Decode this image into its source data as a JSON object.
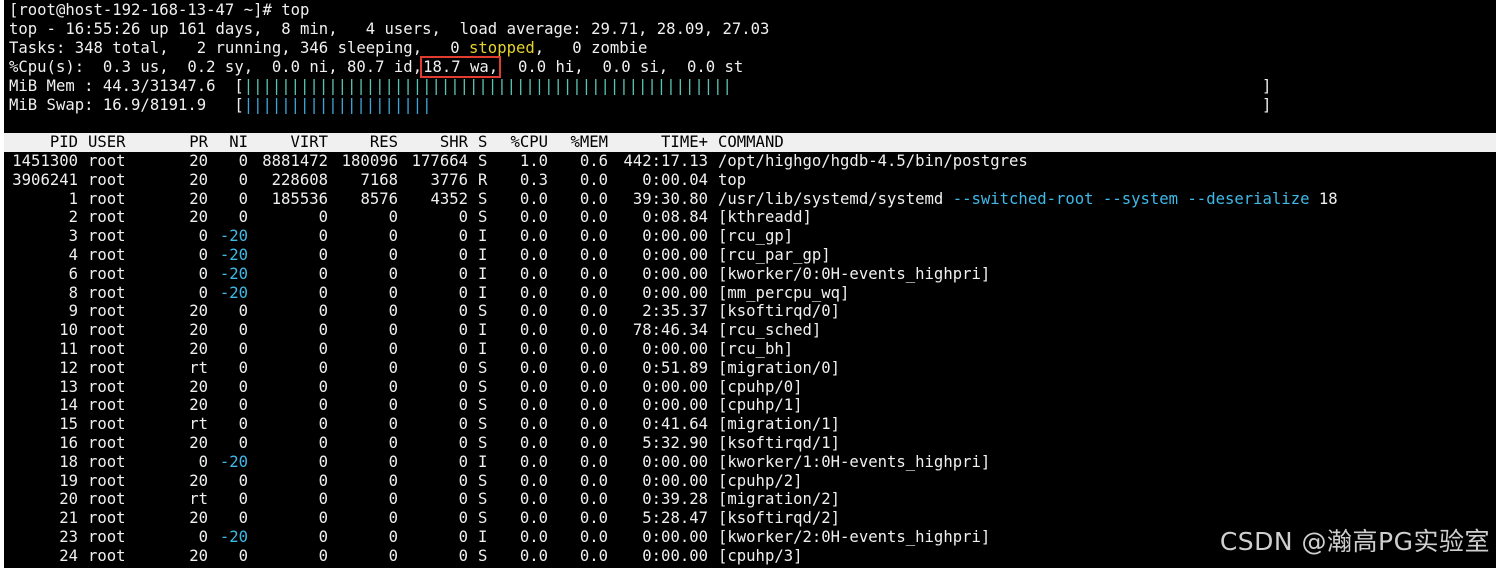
{
  "prompt_line": "[root@host-192-168-13-47 ~]# top",
  "summary": {
    "top_line": "top - 16:55:26 up 161 days,  8 min,   4 users,  load average: 29.71, 28.09, 27.03",
    "tasks_a": "Tasks: 348 total,   2 running, 346 sleeping,   0 ",
    "tasks_stopped": "stopped",
    "tasks_b": ",   0 zombie",
    "cpu_a": "%Cpu(s):  0.3 us,  0.2 sy,  0.0 ni, 80.7 id,",
    "cpu_wa": "18.7 wa,",
    "cpu_b": "  0.0 hi,  0.0 si,  0.0 st",
    "mem_label": "MiB Mem : 44.3/31347.6  [",
    "mem_bar": "||||||||||||||||||||||||||||||||||||||||||||||||||||",
    "swap_label": "MiB Swap: 16.9/8191.9   [",
    "swap_bar": "||||||||||||||||||||",
    "bar_close": "]"
  },
  "table_header": {
    "pid": "PID",
    "user": "USER",
    "pr": "PR",
    "ni": "NI",
    "virt": "VIRT",
    "res": "RES",
    "shr": "SHR",
    "s": "S",
    "cpu": "%CPU",
    "mem": "%MEM",
    "time": "TIME+",
    "command": "COMMAND"
  },
  "processes": [
    {
      "pid": "1451300",
      "user": "root",
      "pr": "20",
      "ni": "0",
      "virt": "8881472",
      "res": "180096",
      "shr": "177664",
      "s": "S",
      "cpu": "1.0",
      "mem": "0.6",
      "time": "442:17.13",
      "command": "/opt/highgo/hgdb-4.5/bin/postgres",
      "args": ""
    },
    {
      "pid": "3906241",
      "user": "root",
      "pr": "20",
      "ni": "0",
      "virt": "228608",
      "res": "7168",
      "shr": "3776",
      "s": "R",
      "cpu": "0.3",
      "mem": "0.0",
      "time": "0:00.04",
      "command": "top",
      "args": ""
    },
    {
      "pid": "1",
      "user": "root",
      "pr": "20",
      "ni": "0",
      "virt": "185536",
      "res": "8576",
      "shr": "4352",
      "s": "S",
      "cpu": "0.0",
      "mem": "0.0",
      "time": "39:30.80",
      "command": "/usr/lib/systemd/systemd",
      "args": " --switched-root --system --deserialize",
      "tail": " 18"
    },
    {
      "pid": "2",
      "user": "root",
      "pr": "20",
      "ni": "0",
      "virt": "0",
      "res": "0",
      "shr": "0",
      "s": "S",
      "cpu": "0.0",
      "mem": "0.0",
      "time": "0:08.84",
      "command": "[kthreadd]",
      "args": ""
    },
    {
      "pid": "3",
      "user": "root",
      "pr": "0",
      "ni": "-20",
      "virt": "0",
      "res": "0",
      "shr": "0",
      "s": "I",
      "cpu": "0.0",
      "mem": "0.0",
      "time": "0:00.00",
      "command": "[rcu_gp]",
      "args": ""
    },
    {
      "pid": "4",
      "user": "root",
      "pr": "0",
      "ni": "-20",
      "virt": "0",
      "res": "0",
      "shr": "0",
      "s": "I",
      "cpu": "0.0",
      "mem": "0.0",
      "time": "0:00.00",
      "command": "[rcu_par_gp]",
      "args": ""
    },
    {
      "pid": "6",
      "user": "root",
      "pr": "0",
      "ni": "-20",
      "virt": "0",
      "res": "0",
      "shr": "0",
      "s": "I",
      "cpu": "0.0",
      "mem": "0.0",
      "time": "0:00.00",
      "command": "[kworker/0:0H-events_highpri]",
      "args": ""
    },
    {
      "pid": "8",
      "user": "root",
      "pr": "0",
      "ni": "-20",
      "virt": "0",
      "res": "0",
      "shr": "0",
      "s": "I",
      "cpu": "0.0",
      "mem": "0.0",
      "time": "0:00.00",
      "command": "[mm_percpu_wq]",
      "args": ""
    },
    {
      "pid": "9",
      "user": "root",
      "pr": "20",
      "ni": "0",
      "virt": "0",
      "res": "0",
      "shr": "0",
      "s": "S",
      "cpu": "0.0",
      "mem": "0.0",
      "time": "2:35.37",
      "command": "[ksoftirqd/0]",
      "args": ""
    },
    {
      "pid": "10",
      "user": "root",
      "pr": "20",
      "ni": "0",
      "virt": "0",
      "res": "0",
      "shr": "0",
      "s": "I",
      "cpu": "0.0",
      "mem": "0.0",
      "time": "78:46.34",
      "command": "[rcu_sched]",
      "args": ""
    },
    {
      "pid": "11",
      "user": "root",
      "pr": "20",
      "ni": "0",
      "virt": "0",
      "res": "0",
      "shr": "0",
      "s": "I",
      "cpu": "0.0",
      "mem": "0.0",
      "time": "0:00.00",
      "command": "[rcu_bh]",
      "args": ""
    },
    {
      "pid": "12",
      "user": "root",
      "pr": "rt",
      "ni": "0",
      "virt": "0",
      "res": "0",
      "shr": "0",
      "s": "S",
      "cpu": "0.0",
      "mem": "0.0",
      "time": "0:51.89",
      "command": "[migration/0]",
      "args": ""
    },
    {
      "pid": "13",
      "user": "root",
      "pr": "20",
      "ni": "0",
      "virt": "0",
      "res": "0",
      "shr": "0",
      "s": "S",
      "cpu": "0.0",
      "mem": "0.0",
      "time": "0:00.00",
      "command": "[cpuhp/0]",
      "args": ""
    },
    {
      "pid": "14",
      "user": "root",
      "pr": "20",
      "ni": "0",
      "virt": "0",
      "res": "0",
      "shr": "0",
      "s": "S",
      "cpu": "0.0",
      "mem": "0.0",
      "time": "0:00.00",
      "command": "[cpuhp/1]",
      "args": ""
    },
    {
      "pid": "15",
      "user": "root",
      "pr": "rt",
      "ni": "0",
      "virt": "0",
      "res": "0",
      "shr": "0",
      "s": "S",
      "cpu": "0.0",
      "mem": "0.0",
      "time": "0:41.64",
      "command": "[migration/1]",
      "args": ""
    },
    {
      "pid": "16",
      "user": "root",
      "pr": "20",
      "ni": "0",
      "virt": "0",
      "res": "0",
      "shr": "0",
      "s": "S",
      "cpu": "0.0",
      "mem": "0.0",
      "time": "5:32.90",
      "command": "[ksoftirqd/1]",
      "args": ""
    },
    {
      "pid": "18",
      "user": "root",
      "pr": "0",
      "ni": "-20",
      "virt": "0",
      "res": "0",
      "shr": "0",
      "s": "I",
      "cpu": "0.0",
      "mem": "0.0",
      "time": "0:00.00",
      "command": "[kworker/1:0H-events_highpri]",
      "args": ""
    },
    {
      "pid": "19",
      "user": "root",
      "pr": "20",
      "ni": "0",
      "virt": "0",
      "res": "0",
      "shr": "0",
      "s": "S",
      "cpu": "0.0",
      "mem": "0.0",
      "time": "0:00.00",
      "command": "[cpuhp/2]",
      "args": ""
    },
    {
      "pid": "20",
      "user": "root",
      "pr": "rt",
      "ni": "0",
      "virt": "0",
      "res": "0",
      "shr": "0",
      "s": "S",
      "cpu": "0.0",
      "mem": "0.0",
      "time": "0:39.28",
      "command": "[migration/2]",
      "args": ""
    },
    {
      "pid": "21",
      "user": "root",
      "pr": "20",
      "ni": "0",
      "virt": "0",
      "res": "0",
      "shr": "0",
      "s": "S",
      "cpu": "0.0",
      "mem": "0.0",
      "time": "5:28.47",
      "command": "[ksoftirqd/2]",
      "args": ""
    },
    {
      "pid": "23",
      "user": "root",
      "pr": "0",
      "ni": "-20",
      "virt": "0",
      "res": "0",
      "shr": "0",
      "s": "I",
      "cpu": "0.0",
      "mem": "0.0",
      "time": "0:00.00",
      "command": "[kworker/2:0H-events_highpri]",
      "args": ""
    },
    {
      "pid": "24",
      "user": "root",
      "pr": "20",
      "ni": "0",
      "virt": "0",
      "res": "0",
      "shr": "0",
      "s": "S",
      "cpu": "0.0",
      "mem": "0.0",
      "time": "0:00.00",
      "command": "[cpuhp/3]",
      "args": ""
    }
  ],
  "watermark": "CSDN @瀚高PG实验室",
  "colors": {
    "stopped": "#e6d32a",
    "args": "#3fb9e8",
    "negative_ni": "#3fb9e8",
    "mem_bar": "#58c4b2",
    "swap_bar": "#3ba6da",
    "highlight": "#e23b2f"
  }
}
